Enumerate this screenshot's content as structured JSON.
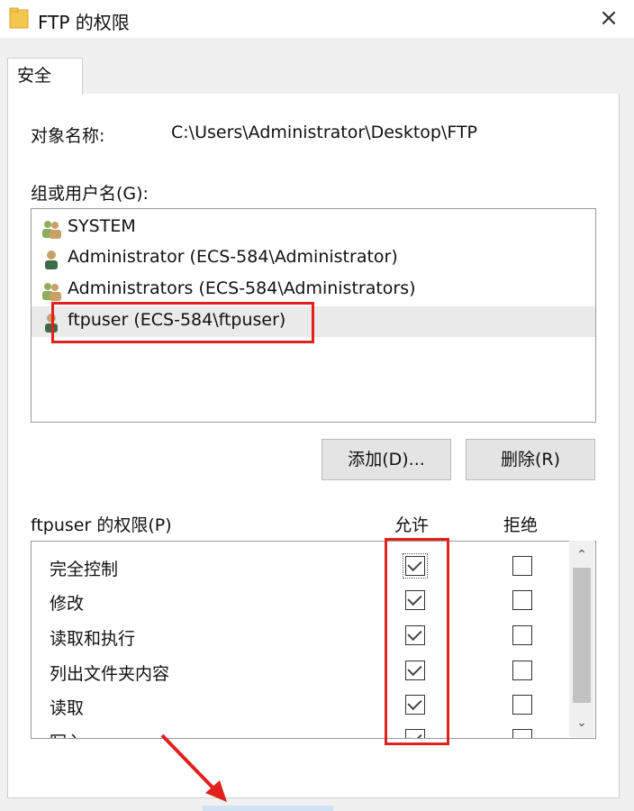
{
  "window": {
    "title": "FTP 的权限",
    "close_label": "×"
  },
  "tabs": [
    {
      "label": "安全"
    }
  ],
  "object": {
    "label": "对象名称:",
    "value": "C:\\Users\\Administrator\\Desktop\\FTP"
  },
  "groups": {
    "label": "组或用户名(G):",
    "items": [
      {
        "name": "SYSTEM",
        "icon": "group-users-icon"
      },
      {
        "name": "Administrator (ECS-584\\Administrator)",
        "icon": "user-icon"
      },
      {
        "name": "Administrators (ECS-584\\Administrators)",
        "icon": "group-users-icon"
      },
      {
        "name": "ftpuser (ECS-584\\ftpuser)",
        "icon": "user-icon",
        "selected": true
      }
    ]
  },
  "buttons": {
    "add": "添加(D)...",
    "remove": "删除(R)"
  },
  "permissions": {
    "label": "ftpuser 的权限(P)",
    "allow_header": "允许",
    "deny_header": "拒绝",
    "rows": [
      {
        "name": "完全控制",
        "allow": true,
        "deny": false
      },
      {
        "name": "修改",
        "allow": true,
        "deny": false
      },
      {
        "name": "读取和执行",
        "allow": true,
        "deny": false
      },
      {
        "name": "列出文件夹内容",
        "allow": true,
        "deny": false
      },
      {
        "name": "读取",
        "allow": true,
        "deny": false
      },
      {
        "name": "写入",
        "allow": true,
        "deny": false
      }
    ]
  },
  "colors": {
    "highlight": "#e0211d",
    "selected_row": "#eaeaea"
  }
}
